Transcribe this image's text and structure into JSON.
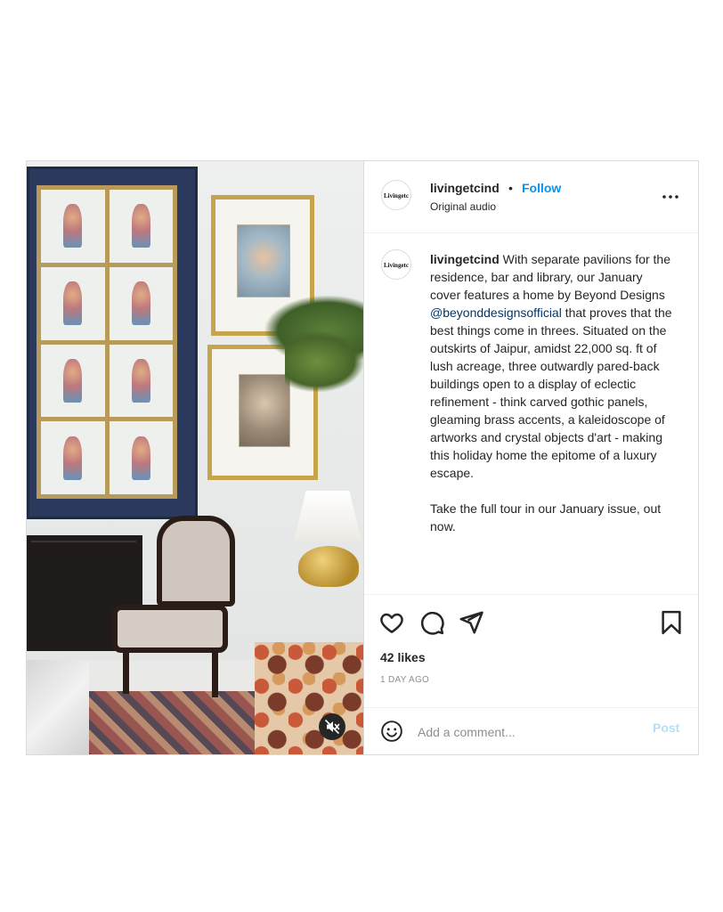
{
  "post": {
    "account": {
      "username": "livingetcind",
      "separator": "•",
      "follow_label": "Follow",
      "audio_label": "Original audio",
      "avatar_logo_text": "Livingetc"
    },
    "caption": {
      "username": "livingetcind",
      "text_before_mention": " With separate pavilions for the residence, bar and library, our January cover features a home by Beyond Designs ",
      "mention": "@beyonddesignsofficial",
      "text_after_mention": " that proves that the best things come in threes. Situated on the outskirts of Jaipur, amidst 22,000 sq. ft of lush acreage, three outwardly pared-back buildings open to a display of eclectic refinement - think carved gothic panels, gleaming brass accents, a kaleidoscope of artworks and crystal objects d'art - making this holiday home the epitome of a luxury escape.",
      "second_paragraph": "Take the full tour in our January issue, out now."
    },
    "likes_text": "42 likes",
    "time_text": "1 DAY AGO",
    "comment": {
      "placeholder": "Add a comment...",
      "value": "",
      "post_label": "Post"
    },
    "icons": {
      "more": "more-options-icon",
      "like": "heart-icon",
      "comment": "comment-bubble-icon",
      "share": "paper-plane-icon",
      "save": "bookmark-icon",
      "emoji": "emoji-smile-icon",
      "mute": "speaker-muted-icon"
    },
    "media": {
      "type": "video",
      "muted": true
    }
  },
  "colors": {
    "follow": "#0095f6",
    "mention": "#00376b",
    "post_disabled": "#b2dffc",
    "muted_text": "#8e8e8e",
    "border": "#dbdbdb"
  }
}
